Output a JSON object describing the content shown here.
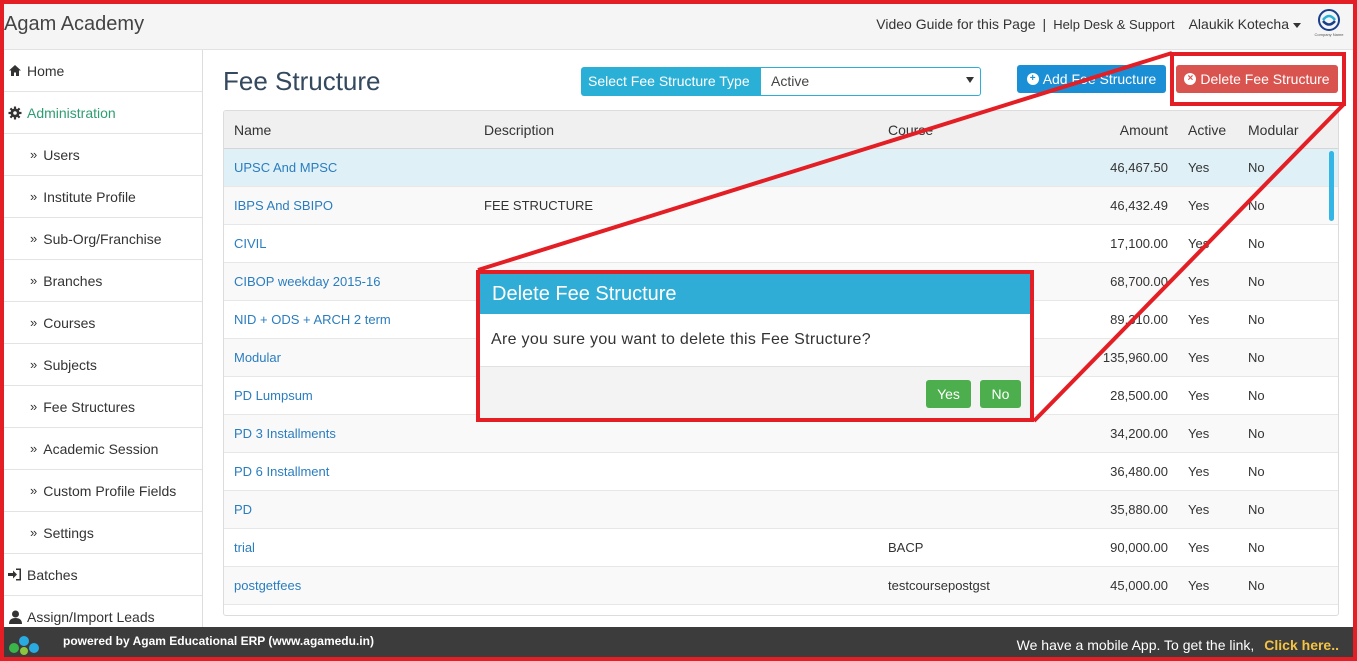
{
  "header": {
    "brand": "Agam Academy",
    "video_guide": "Video Guide for this Page",
    "help_desk": "Help Desk & Support",
    "user": "Alaukik Kotecha",
    "logo_text": "Company Name"
  },
  "sidebar": {
    "items": [
      {
        "label": "Home",
        "icon": "home-icon"
      },
      {
        "label": "Administration",
        "icon": "gear-icon"
      },
      {
        "label": "Users"
      },
      {
        "label": "Institute Profile"
      },
      {
        "label": "Sub-Org/Franchise"
      },
      {
        "label": "Branches"
      },
      {
        "label": "Courses"
      },
      {
        "label": "Subjects"
      },
      {
        "label": "Fee Structures"
      },
      {
        "label": "Academic Session"
      },
      {
        "label": "Custom Profile Fields"
      },
      {
        "label": "Settings"
      },
      {
        "label": "Batches",
        "icon": "sign-in-icon"
      },
      {
        "label": "Assign/Import Leads",
        "icon": "user-icon"
      }
    ]
  },
  "main": {
    "title": "Fee Structure",
    "type_label": "Select Fee Structure Type",
    "type_value": "Active",
    "add_button": "Add Fee Structure",
    "delete_button": "Delete Fee Structure"
  },
  "table": {
    "headers": {
      "name": "Name",
      "description": "Description",
      "course": "Course",
      "amount": "Amount",
      "active": "Active",
      "modular": "Modular"
    },
    "rows": [
      {
        "name": "UPSC And MPSC",
        "description": "",
        "course": "",
        "amount": "46,467.50",
        "active": "Yes",
        "modular": "No"
      },
      {
        "name": "IBPS And SBIPO",
        "description": "FEE STRUCTURE",
        "course": "",
        "amount": "46,432.49",
        "active": "Yes",
        "modular": "No"
      },
      {
        "name": "CIVIL",
        "description": "",
        "course": "",
        "amount": "17,100.00",
        "active": "Yes",
        "modular": "No"
      },
      {
        "name": "CIBOP weekday 2015-16",
        "description": "",
        "course": "",
        "amount": "68,700.00",
        "active": "Yes",
        "modular": "No"
      },
      {
        "name": "NID + ODS + ARCH 2 term",
        "description": "",
        "course": "",
        "amount": "89,310.00",
        "active": "Yes",
        "modular": "No"
      },
      {
        "name": "Modular",
        "description": "",
        "course": "",
        "amount": "135,960.00",
        "active": "Yes",
        "modular": "No"
      },
      {
        "name": "PD Lumpsum",
        "description": "",
        "course": "",
        "amount": "28,500.00",
        "active": "Yes",
        "modular": "No"
      },
      {
        "name": "PD 3 Installments",
        "description": "",
        "course": "",
        "amount": "34,200.00",
        "active": "Yes",
        "modular": "No"
      },
      {
        "name": "PD 6 Installment",
        "description": "",
        "course": "",
        "amount": "36,480.00",
        "active": "Yes",
        "modular": "No"
      },
      {
        "name": "PD",
        "description": "",
        "course": "",
        "amount": "35,880.00",
        "active": "Yes",
        "modular": "No"
      },
      {
        "name": "trial",
        "description": "",
        "course": "BACP",
        "amount": "90,000.00",
        "active": "Yes",
        "modular": "No"
      },
      {
        "name": "postgetfees",
        "description": "",
        "course": "testcoursepostgst",
        "amount": "45,000.00",
        "active": "Yes",
        "modular": "No"
      }
    ]
  },
  "modal": {
    "title": "Delete Fee Structure",
    "message": "Are you sure you want to delete this Fee Structure?",
    "yes": "Yes",
    "no": "No"
  },
  "footer": {
    "powered": "powered by Agam Educational ERP (www.agamedu.in)",
    "mobile_text": "We have a mobile App. To get the link,",
    "click_here": "Click here.."
  },
  "colors": {
    "accent": "#2fadd6",
    "danger": "#d9534f",
    "primary": "#1b8fd6",
    "success": "#4cae4c",
    "annotation": "#e31e24"
  }
}
